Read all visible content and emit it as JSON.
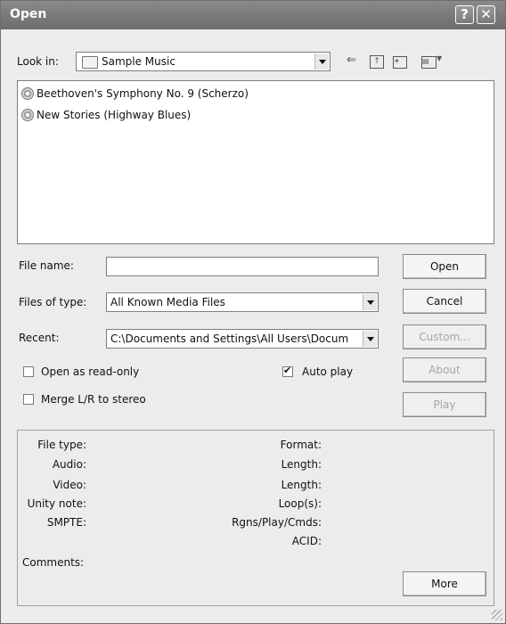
{
  "window": {
    "title": "Open",
    "help_btn": "?",
    "close_btn": "✕"
  },
  "lookin": {
    "label": "Look in:",
    "value": "Sample Music"
  },
  "files": [
    {
      "name": "Beethoven's Symphony No. 9 (Scherzo)"
    },
    {
      "name": "New Stories (Highway Blues)"
    }
  ],
  "filename": {
    "label": "File name:",
    "value": ""
  },
  "filetype": {
    "label": "Files of type:",
    "value": "All Known Media Files"
  },
  "recent": {
    "label": "Recent:",
    "value": "C:\\Documents and Settings\\All Users\\Docum"
  },
  "buttons": {
    "open": "Open",
    "cancel": "Cancel",
    "custom": "Custom...",
    "about": "About",
    "play": "Play",
    "more": "More"
  },
  "checkboxes": {
    "readonly": {
      "label": "Open as read-only",
      "checked": false
    },
    "autoplay": {
      "label": "Auto play",
      "checked": true
    },
    "merge": {
      "label": "Merge L/R to stereo",
      "checked": false
    }
  },
  "info": {
    "file_type": "File type:",
    "audio": "Audio:",
    "video": "Video:",
    "unity_note": "Unity note:",
    "smpte": "SMPTE:",
    "comments": "Comments:",
    "format": "Format:",
    "length1": "Length:",
    "length2": "Length:",
    "loops": "Loop(s):",
    "rgns": "Rgns/Play/Cmds:",
    "acid": "ACID:"
  },
  "icons": [
    "folder-icon",
    "back-arrow-icon",
    "up-folder-icon",
    "new-folder-icon",
    "view-menu-icon",
    "cd-audio-icon",
    "resize-grip-icon"
  ]
}
